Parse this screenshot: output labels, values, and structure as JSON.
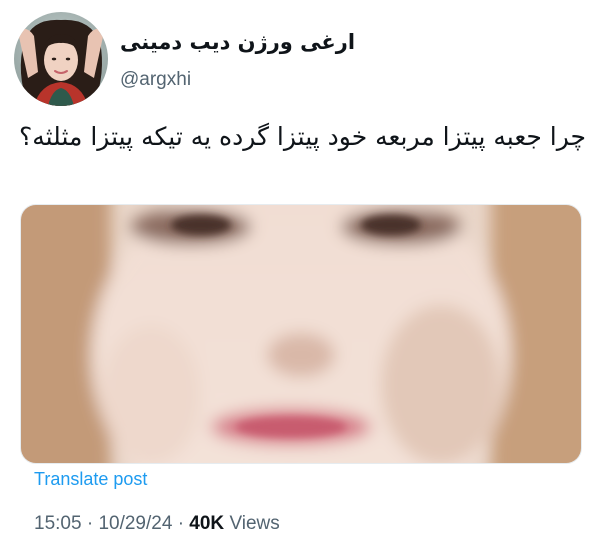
{
  "author": {
    "display_name": "ارغی ورژن دیب دمینی",
    "handle": "@argxhi",
    "avatar_icon": "profile-photo"
  },
  "tweet": {
    "text": "چرا جعبه پیتزا مربعه خود پیتزا گرده یه تیکه پیتزا مثلثه؟",
    "media_icon": "blurred-face-photo"
  },
  "actions": {
    "translate_label": "Translate post"
  },
  "meta": {
    "time": "15:05",
    "separator": "·",
    "date": "10/29/24",
    "views_count": "40K",
    "views_label": "Views"
  },
  "colors": {
    "link": "#1d9bf0",
    "secondary_text": "#536471",
    "primary_text": "#0f1419"
  }
}
